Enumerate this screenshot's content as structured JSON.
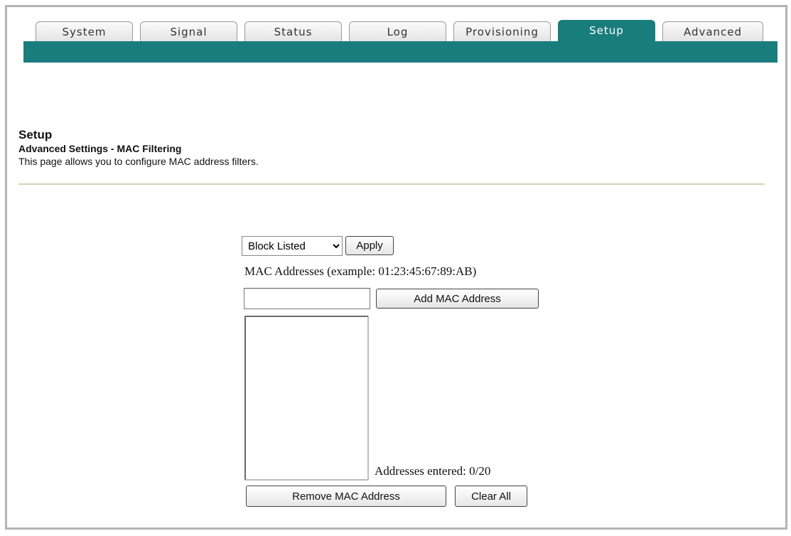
{
  "tabs": [
    {
      "label": "System"
    },
    {
      "label": "Signal"
    },
    {
      "label": "Status"
    },
    {
      "label": "Log"
    },
    {
      "label": "Provisioning"
    },
    {
      "label": "Setup",
      "active": true
    },
    {
      "label": "Advanced"
    }
  ],
  "colors": {
    "accent": "#1a7d7d",
    "rule": "#d6d2b8"
  },
  "header": {
    "page_title": "Setup",
    "section_title": "Advanced Settings - MAC Filtering",
    "description": "This page allows you to configure MAC address filters."
  },
  "filter": {
    "mode_selected": "Block Listed",
    "apply_label": "Apply"
  },
  "mac": {
    "label": "MAC Addresses (example: 01:23:45:67:89:AB)",
    "input_value": "",
    "add_label": "Add MAC Address",
    "list_items": [],
    "count_text": "Addresses entered: 0/20",
    "remove_label": "Remove MAC Address",
    "clear_label": "Clear All"
  }
}
